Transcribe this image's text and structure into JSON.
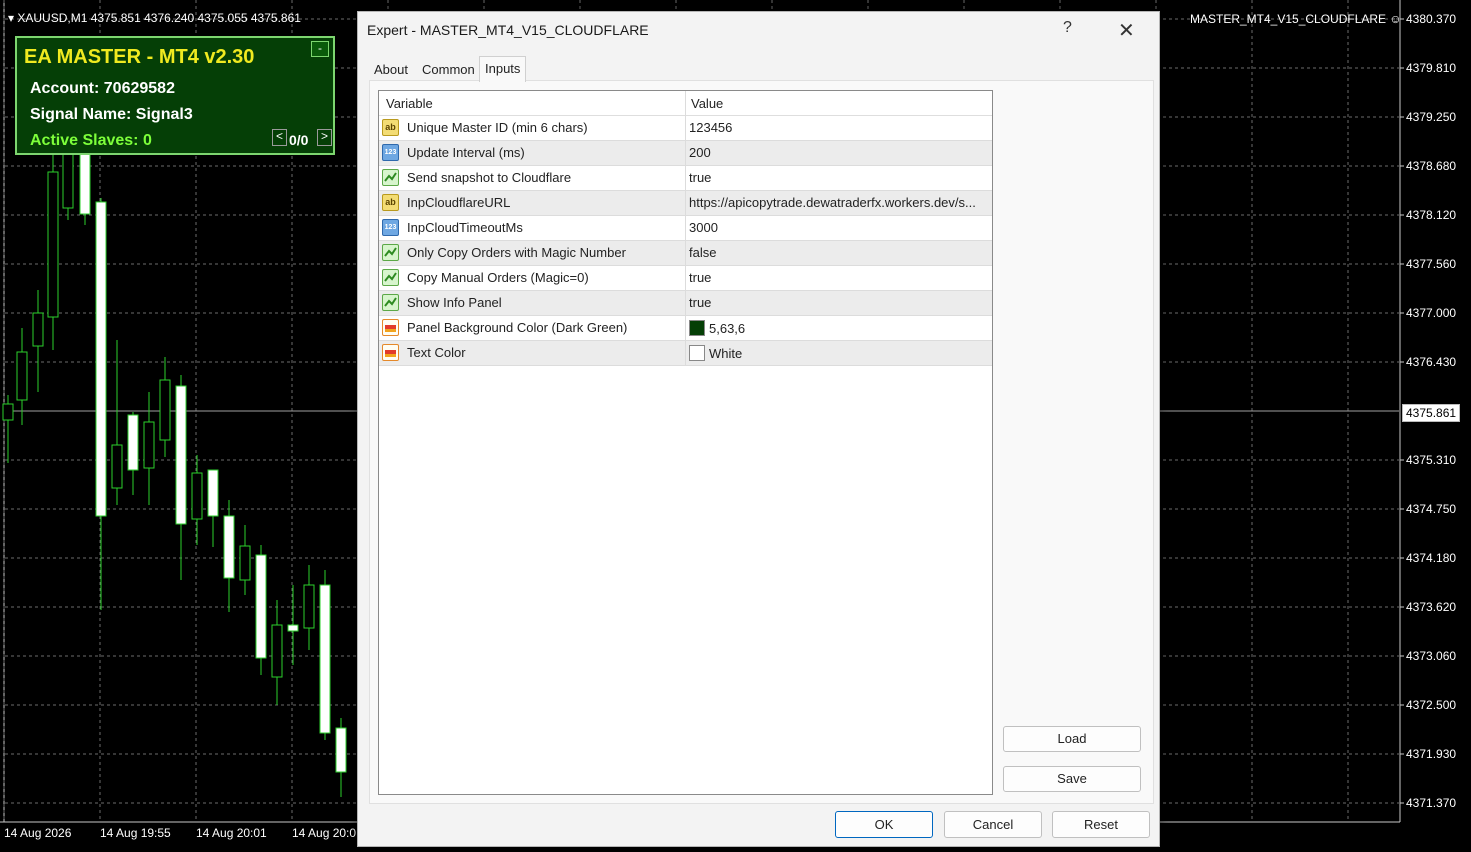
{
  "chart": {
    "symbol_line": "XAUUSD,M1  4375.851 4376.240 4375.055 4375.861",
    "ea_name": "MASTER_MT4_V15_CLOUDFLARE",
    "price_labels": [
      "4380.370",
      "4379.810",
      "4379.250",
      "4378.680",
      "4378.120",
      "4377.560",
      "4377.000",
      "4376.430",
      "4375.310",
      "4374.750",
      "4374.180",
      "4373.620",
      "4373.060",
      "4372.500",
      "4371.930",
      "4371.370"
    ],
    "current_price": "4375.861",
    "time_labels": [
      "14 Aug 2026",
      "14 Aug 19:55",
      "14 Aug 20:01",
      "14 Aug 20:0"
    ],
    "colors": {
      "background": "#000000",
      "grid": "#6b6b6b",
      "wick": "#2bd12b",
      "bull_body": "#000000",
      "bear_body": "#ffffff"
    }
  },
  "info_panel": {
    "title": "EA MASTER - MT4  v2.30",
    "account": "Account: 70629582",
    "signal": "Signal Name: Signal3",
    "active_slaves": "Active Slaves:  0",
    "minimize": "-",
    "prev": "<",
    "next": ">",
    "page": "0/0",
    "colors": {
      "background": "#053f06",
      "title": "#f0ea20",
      "accent": "#7dff3a"
    }
  },
  "dialog": {
    "title": "Expert - MASTER_MT4_V15_CLOUDFLARE",
    "help": "?",
    "close": "✕",
    "tabs": [
      "About",
      "Common",
      "Inputs"
    ],
    "active_tab": "Inputs",
    "columns": [
      "Variable",
      "Value"
    ],
    "rows": [
      {
        "icon": "string-icon",
        "glyph": "ab",
        "name": "Unique Master ID (min 6 chars)",
        "value": "123456"
      },
      {
        "icon": "integer-icon",
        "glyph": "123",
        "name": "Update Interval (ms)",
        "value": "200"
      },
      {
        "icon": "boolean-icon",
        "glyph": "",
        "name": "Send snapshot to Cloudflare",
        "value": "true"
      },
      {
        "icon": "string-icon",
        "glyph": "ab",
        "name": "InpCloudflareURL",
        "value": "https://apicopytrade.dewatraderfx.workers.dev/s..."
      },
      {
        "icon": "integer-icon",
        "glyph": "123",
        "name": "InpCloudTimeoutMs",
        "value": "3000"
      },
      {
        "icon": "boolean-icon",
        "glyph": "",
        "name": "Only Copy Orders with Magic Number",
        "value": "false"
      },
      {
        "icon": "boolean-icon",
        "glyph": "",
        "name": "Copy Manual Orders (Magic=0)",
        "value": "true"
      },
      {
        "icon": "boolean-icon",
        "glyph": "",
        "name": "Show Info Panel",
        "value": "true"
      },
      {
        "icon": "color-icon",
        "glyph": "",
        "name": "Panel Background Color (Dark Green)",
        "value": "5,63,6",
        "swatch": "#053f06"
      },
      {
        "icon": "color-icon",
        "glyph": "",
        "name": "Text Color",
        "value": "White",
        "swatch": "#ffffff"
      }
    ],
    "buttons": {
      "load": "Load",
      "save": "Save",
      "ok": "OK",
      "cancel": "Cancel",
      "reset": "Reset"
    }
  }
}
